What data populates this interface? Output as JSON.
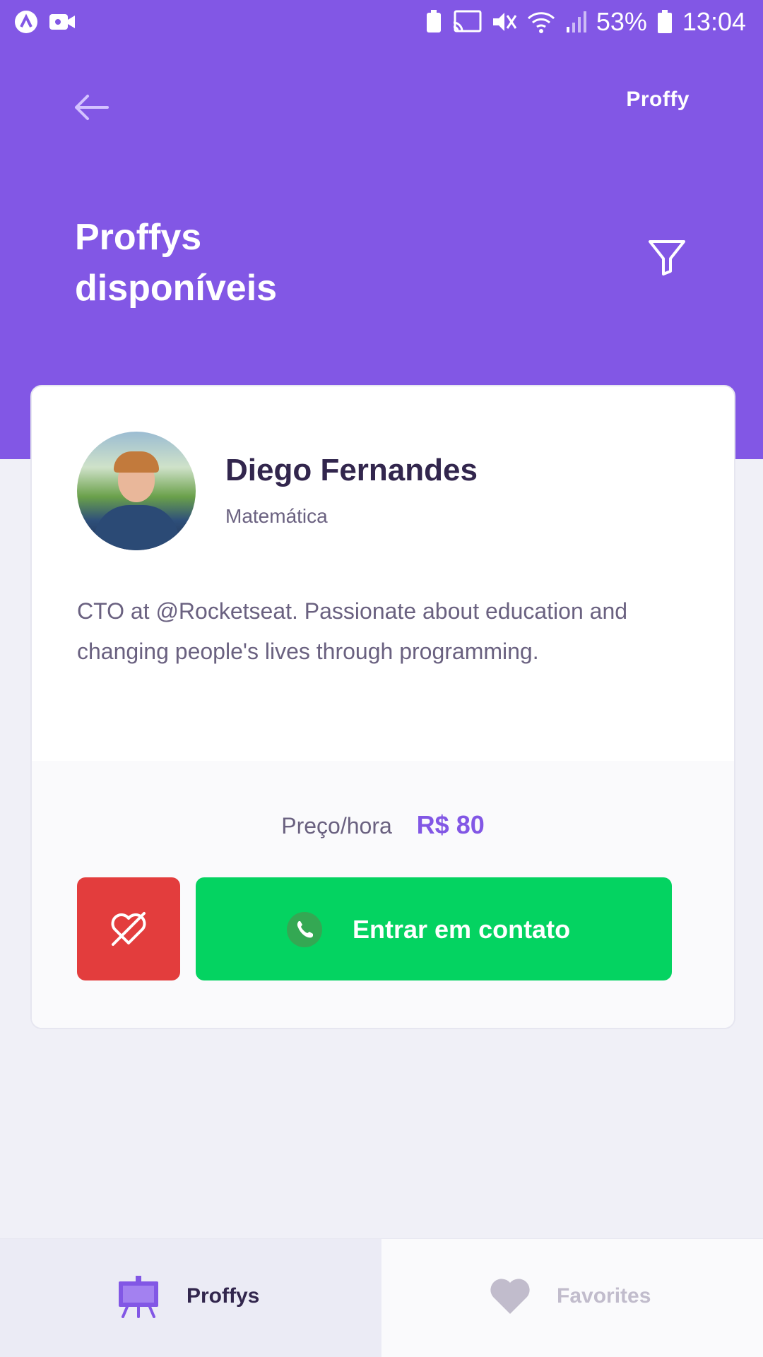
{
  "status_bar": {
    "battery": "53%",
    "time": "13:04"
  },
  "header": {
    "brand": "Proffy",
    "title": "Proffys\ndisponíveis",
    "icons": {
      "back": "arrow-left-icon",
      "filter": "filter-icon"
    }
  },
  "teacher": {
    "name": "Diego Fernandes",
    "subject": "Matemática",
    "bio": "CTO at @Rocketseat. Passionate about education and changing people's lives through programming.",
    "price_label": "Preço/hora",
    "price": "R$ 80",
    "contact_label": "Entrar em contato"
  },
  "tabs": [
    {
      "label": "Proffys",
      "icon": "easel-icon",
      "active": true
    },
    {
      "label": "Favorites",
      "icon": "heart-icon",
      "active": false
    }
  ],
  "colors": {
    "primary": "#8257E5",
    "background": "#F0F0F7",
    "danger": "#E33D3D",
    "success": "#04D361",
    "title_text": "#32264D",
    "body_text": "#6A6180"
  }
}
